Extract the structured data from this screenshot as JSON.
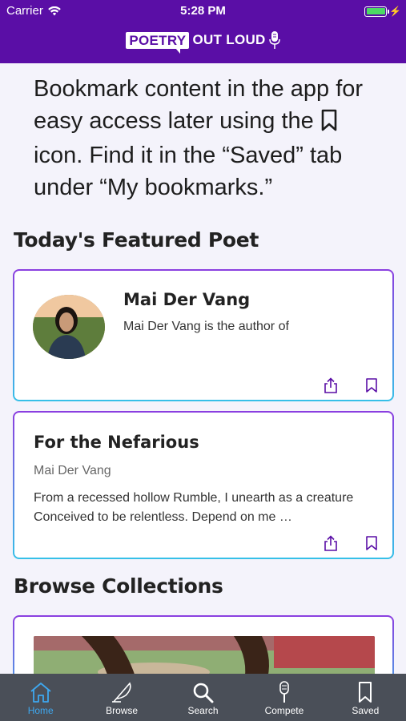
{
  "status": {
    "carrier": "Carrier",
    "time": "5:28 PM"
  },
  "header": {
    "logo_left": "POETRY",
    "logo_right": "OUT LOUD"
  },
  "intro": {
    "line1": "Bookmark content in the app for easy access later using the",
    "line2": "icon. Find it in the “Saved” tab under “My bookmarks.”"
  },
  "featured": {
    "heading": "Today's Featured Poet",
    "poet_name": "Mai Der Vang",
    "poet_desc": "Mai Der Vang is the author of"
  },
  "poem": {
    "title": "For the Nefarious",
    "author": "Mai Der Vang",
    "excerpt": "From a recessed hollow Rumble, I unearth as a creature Conceived to be relentless. Depend on me …"
  },
  "collections": {
    "heading": "Browse Collections"
  },
  "tabs": [
    {
      "label": "Home",
      "icon": "home-icon",
      "active": true
    },
    {
      "label": "Browse",
      "icon": "quill-icon",
      "active": false
    },
    {
      "label": "Search",
      "icon": "search-icon",
      "active": false
    },
    {
      "label": "Compete",
      "icon": "microphone-icon",
      "active": false
    },
    {
      "label": "Saved",
      "icon": "bookmark-icon",
      "active": false
    }
  ],
  "colors": {
    "brand": "#5a0ea6",
    "tab_active": "#3ea8f0",
    "tabbar_bg": "#4a4f58"
  }
}
